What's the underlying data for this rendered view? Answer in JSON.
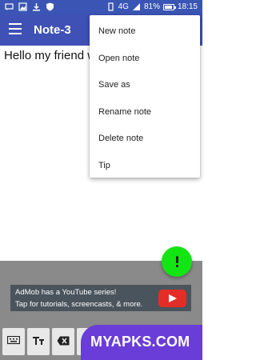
{
  "status_bar": {
    "network": "4G",
    "battery": "81%",
    "time": "18:15",
    "left_icons": [
      "message-icon",
      "image-icon",
      "download-icon",
      "shield-icon"
    ]
  },
  "app_bar": {
    "title": "Note-3",
    "menu_icon": "hamburger-menu-icon"
  },
  "editor": {
    "text": "Hello my friend w"
  },
  "overflow_menu": {
    "items": [
      "New note",
      "Open note",
      "Save as",
      "Rename note",
      "Delete note",
      "Tip"
    ]
  },
  "fab": {
    "icon": "exclamation-icon",
    "color": "#12e612"
  },
  "ad": {
    "line1": "AdMob has a YouTube series!",
    "line2": "Tap for tutorials, screencasts, & more.",
    "logo": "youtube-play-icon"
  },
  "toolbar": {
    "buttons": [
      "keyboard-icon",
      "text-size-icon",
      "backspace-icon",
      "space-icon"
    ]
  },
  "watermark": {
    "text": "MYAPKS.COM"
  },
  "colors": {
    "primary": "#3f51b5",
    "status_bar": "#3a55b3",
    "bottom_panel": "#8a8a8a",
    "watermark": "#6a3cd8"
  }
}
